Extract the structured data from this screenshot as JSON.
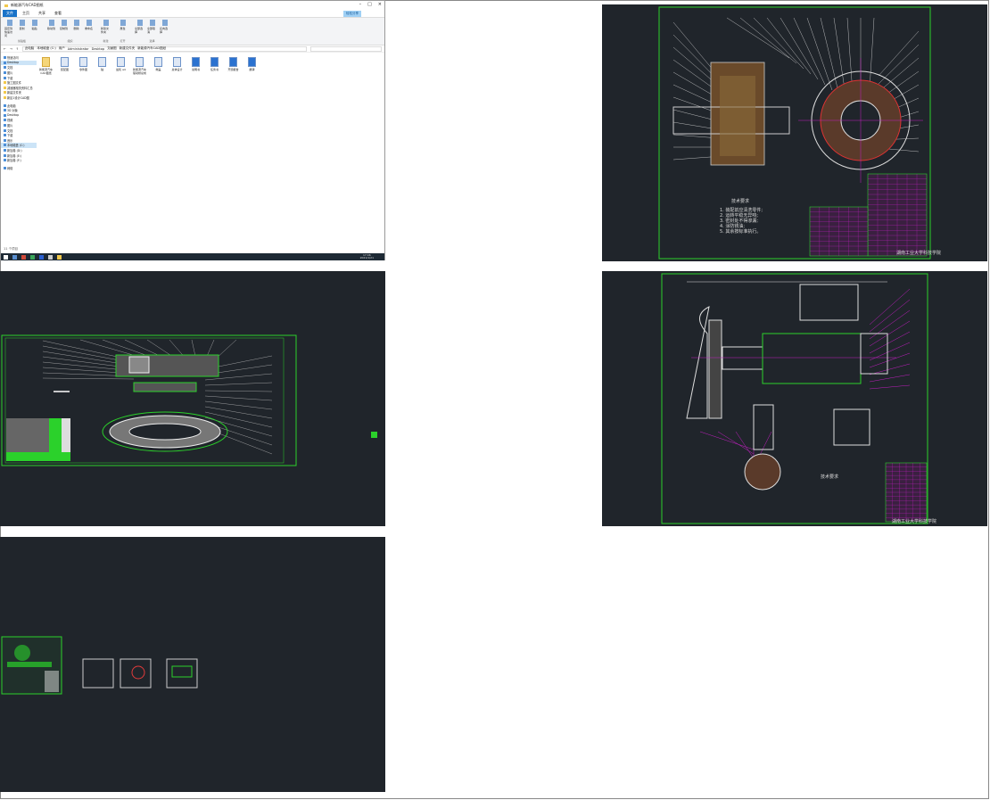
{
  "explorer": {
    "title": "新能源汽车CAD图纸",
    "tabs": [
      "文件",
      "主页",
      "共享",
      "查看"
    ],
    "share_button": "轻松分享",
    "ribbon_groups": [
      {
        "label": "剪贴板",
        "buttons": [
          "固定到快速访问",
          "复制",
          "粘贴"
        ]
      },
      {
        "label": "组织",
        "buttons": [
          "移动到",
          "复制到",
          "删除",
          "重命名"
        ]
      },
      {
        "label": "新建",
        "buttons": [
          "新建文件夹"
        ]
      },
      {
        "label": "打开",
        "buttons": [
          "属性"
        ]
      },
      {
        "label": "选择",
        "buttons": [
          "全部选择",
          "全部取消",
          "反向选择"
        ]
      }
    ],
    "address_path": [
      "此电脑",
      "本地磁盘 (C:)",
      "用户",
      "Administrator",
      "Desktop",
      "文献图",
      "新建文件夹",
      "新能源汽车CAD图纸"
    ],
    "nav_items": [
      {
        "label": "快速访问",
        "icon": "star"
      },
      {
        "label": "Desktop",
        "icon": "desktop",
        "selected": true
      },
      {
        "label": "文档",
        "icon": "document"
      },
      {
        "label": "图片",
        "icon": "picture"
      },
      {
        "label": "下载",
        "icon": "download"
      },
      {
        "label": "施工图文件",
        "icon": "folder"
      },
      {
        "label": "减速器相关资料汇总",
        "icon": "folder"
      },
      {
        "label": "新建文件夹",
        "icon": "folder"
      },
      {
        "label": "新区1设计CAD图",
        "icon": "folder"
      },
      {
        "label": "此电脑",
        "icon": "computer"
      },
      {
        "label": "3D 对象",
        "icon": "cube"
      },
      {
        "label": "Desktop",
        "icon": "desktop"
      },
      {
        "label": "视频",
        "icon": "video"
      },
      {
        "label": "图片",
        "icon": "picture"
      },
      {
        "label": "文档",
        "icon": "document"
      },
      {
        "label": "下载",
        "icon": "download"
      },
      {
        "label": "音乐",
        "icon": "music"
      },
      {
        "label": "本地磁盘 (C:)",
        "icon": "drive",
        "selected": true
      },
      {
        "label": "新加卷 (D:)",
        "icon": "drive"
      },
      {
        "label": "新加卷 (E:)",
        "icon": "drive"
      },
      {
        "label": "新加卷 (F:)",
        "icon": "drive"
      },
      {
        "label": "网络",
        "icon": "network"
      }
    ],
    "files": [
      {
        "name": "新能源汽车CAD图纸",
        "type": "folder"
      },
      {
        "name": "装配图",
        "type": "dwg"
      },
      {
        "name": "零件图",
        "type": "dwg"
      },
      {
        "name": "轴",
        "type": "dwg"
      },
      {
        "name": "齿轮 a4",
        "type": "dwg"
      },
      {
        "name": "新能源汽车驱动桥总成",
        "type": "dwg"
      },
      {
        "name": "端盖",
        "type": "dwg"
      },
      {
        "name": "总体设计",
        "type": "dwg"
      },
      {
        "name": "说明书",
        "type": "doc"
      },
      {
        "name": "任务书",
        "type": "doc"
      },
      {
        "name": "开题报告",
        "type": "doc"
      },
      {
        "name": "翻译",
        "type": "doc"
      }
    ],
    "status": "11 个项目",
    "clock_time": "17:46",
    "clock_date": "2021/1/21"
  },
  "drawings": {
    "top_right": {
      "tech_title": "技术要求",
      "tech_lines": [
        "1. 装配前应清洗零件;",
        "2. 运转平稳无异响;",
        "3. 密封处不得渗漏;",
        "4. 涂防锈油;",
        "5. 其余按标准执行。"
      ],
      "school": "湖南工业大学科技学院"
    },
    "mid_right": {
      "tech_title": "技术要求",
      "school": "湖南工业大学科技学院"
    }
  },
  "colors": {
    "cad_bg": "#20252b",
    "cad_green": "#2bd12b",
    "cad_magenta": "#c31fc3",
    "cad_white": "#e6e6e6",
    "cad_red": "#e23b3b",
    "accent": "#1a73c8"
  }
}
